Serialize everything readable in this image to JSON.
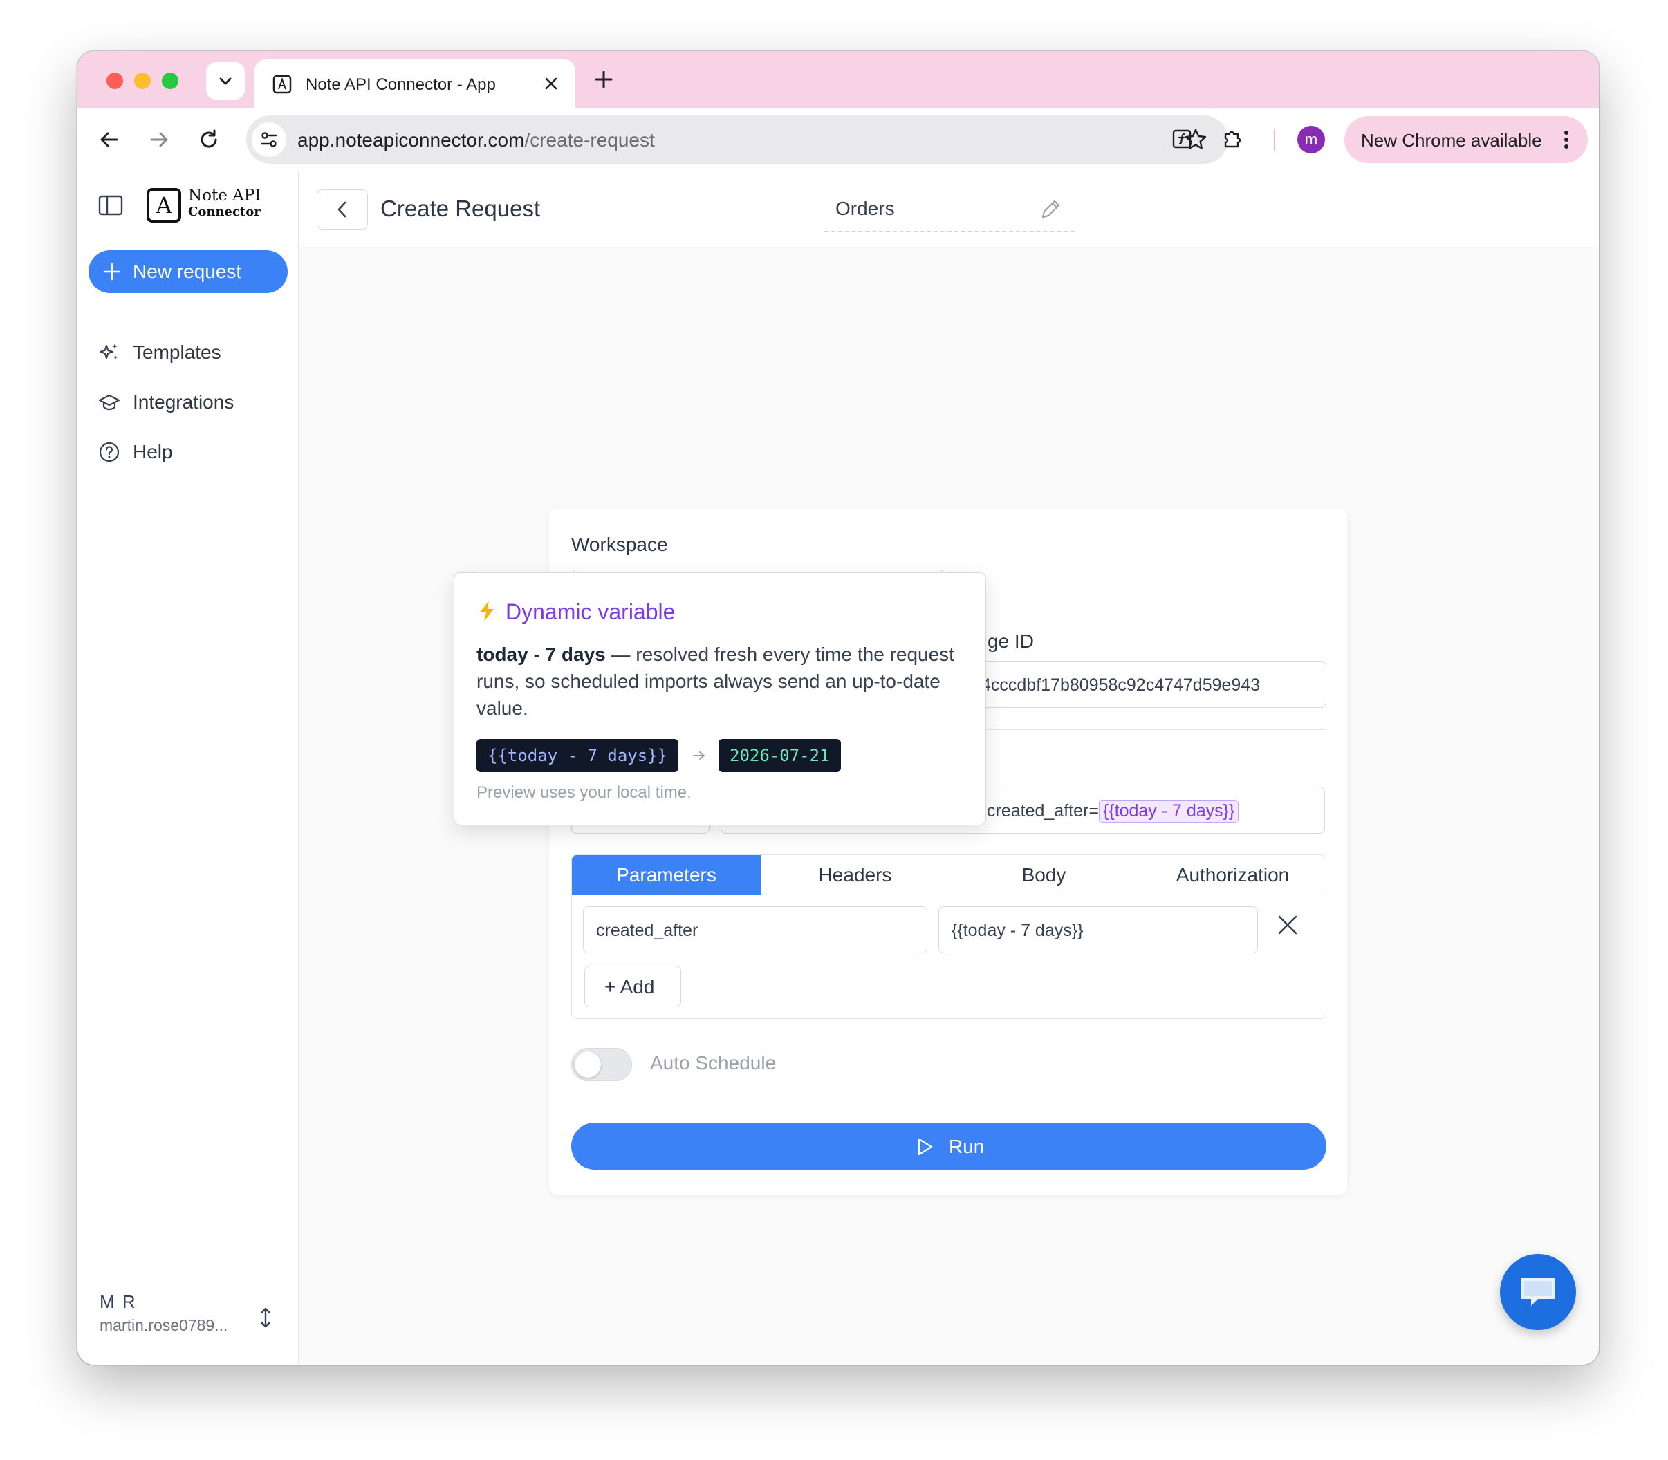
{
  "browser": {
    "tab_title": "Note API Connector - App",
    "url_host": "app.noteapiconnector.com",
    "url_path": "/create-request",
    "profile_initial": "m",
    "update_label": "New Chrome available"
  },
  "sidebar": {
    "logo_line1": "Note API",
    "logo_line2": "Connector",
    "logo_mark": "A",
    "new_request_label": "New request",
    "items": [
      {
        "label": "Templates",
        "icon": "sparkles-icon"
      },
      {
        "label": "Integrations",
        "icon": "graduation-cap-icon"
      },
      {
        "label": "Help",
        "icon": "help-circle-icon"
      }
    ],
    "user": {
      "initials": "M R",
      "email": "martin.rose0789..."
    }
  },
  "header": {
    "title": "Create Request",
    "request_name": "Orders"
  },
  "form": {
    "workspace_label": "Workspace",
    "page_id_label_visible": "ge ID",
    "page_id_value": "4cccdbf17b80958c92c4747d59e943",
    "url_prefix_visible": "created_after=",
    "url_variable": "{{today - 7 days}}",
    "tabs": [
      "Parameters",
      "Headers",
      "Body",
      "Authorization"
    ],
    "active_tab": "Parameters",
    "params": [
      {
        "key": "created_after",
        "value": "{{today - 7 days}}"
      }
    ],
    "add_label": "+ Add",
    "auto_schedule_label": "Auto Schedule",
    "auto_schedule_on": false,
    "run_label": "Run"
  },
  "popover": {
    "title": "Dynamic variable",
    "expression": "today - 7 days",
    "description": " — resolved fresh every time the request runs, so scheduled imports always send an up-to-date value.",
    "code_from": "{{today - 7 days}}",
    "code_to": "2026-07-21",
    "note": "Preview uses your local time."
  },
  "colors": {
    "accent": "#3b82f6",
    "variable": "#7c3aed",
    "tabstrip": "#f8d3e5"
  }
}
